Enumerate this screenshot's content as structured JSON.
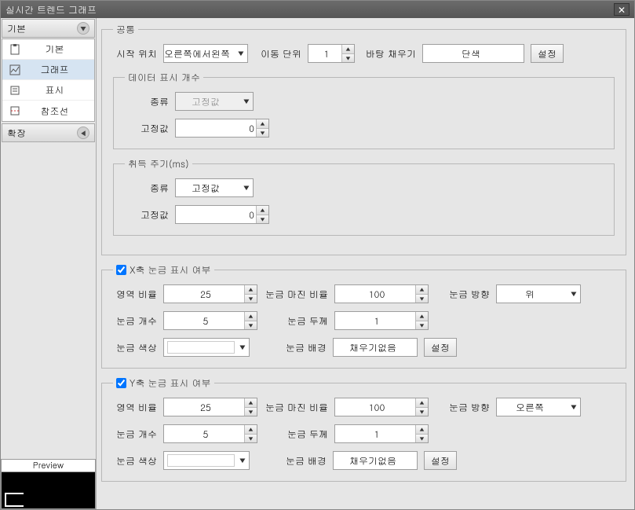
{
  "window": {
    "title": "실시간 트렌드 그래프"
  },
  "sidebar": {
    "section_basic": "기본",
    "section_expand": "확장",
    "items": [
      {
        "label": "기본"
      },
      {
        "label": "그래프"
      },
      {
        "label": "표시"
      },
      {
        "label": "참조선"
      }
    ],
    "preview_label": "Preview"
  },
  "common": {
    "legend": "공통",
    "start_pos_label": "시작 위치",
    "start_pos_value": "오른쪽에서왼쪽",
    "move_unit_label": "이동 단위",
    "move_unit_value": "1",
    "bg_fill_label": "바탕 채우기",
    "bg_fill_value": "단색",
    "setting_btn": "설정",
    "data_count": {
      "legend": "데이터 표시 개수",
      "type_label": "종류",
      "type_value": "고정값",
      "fixed_label": "고정값",
      "fixed_value": "0"
    },
    "acq_cycle": {
      "legend": "취득 주기(ms)",
      "type_label": "종류",
      "type_value": "고정값",
      "fixed_label": "고정값",
      "fixed_value": "0"
    }
  },
  "xaxis": {
    "legend": "X축 눈금 표시 여부",
    "checked": true,
    "area_ratio_label": "영역 비율",
    "area_ratio_value": "25",
    "margin_ratio_label": "눈금 마진 비율",
    "margin_ratio_value": "100",
    "direction_label": "눈금 방향",
    "direction_value": "위",
    "count_label": "눈금 개수",
    "count_value": "5",
    "thickness_label": "눈금 두께",
    "thickness_value": "1",
    "color_label": "눈금 색상",
    "bg_label": "눈금 배경",
    "bg_value": "채우기없음",
    "setting_btn": "설정"
  },
  "yaxis": {
    "legend": "Y축 눈금 표시 여부",
    "checked": true,
    "area_ratio_label": "영역 비율",
    "area_ratio_value": "25",
    "margin_ratio_label": "눈금 마진 비율",
    "margin_ratio_value": "100",
    "direction_label": "눈금 방향",
    "direction_value": "오른쪽",
    "count_label": "눈금 개수",
    "count_value": "5",
    "thickness_label": "눈금 두께",
    "thickness_value": "1",
    "color_label": "눈금 색상",
    "bg_label": "눈금 배경",
    "bg_value": "채우기없음",
    "setting_btn": "설정"
  }
}
